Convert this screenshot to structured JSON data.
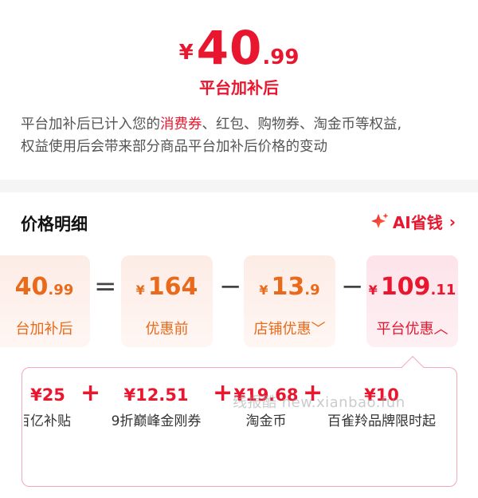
{
  "summary": {
    "currency": "¥",
    "price_int": "40",
    "price_dec": ".99",
    "label": "平台加补后",
    "note_before": "平台加补后已计入您的",
    "note_highlight": "消费券",
    "note_after": "、红包、购物券、淘金币等权益,",
    "note_line2": "权益使用后会带来部分商品平台加补后价格的变动"
  },
  "detail": {
    "title": "价格明细",
    "ai_label": "AI省钱",
    "chevron": "›"
  },
  "cards": [
    {
      "currency": "¥",
      "int": "40",
      "dec": ".99",
      "label": "台加补后"
    },
    {
      "currency": "¥",
      "int": "164",
      "dec": "",
      "label": "优惠前"
    },
    {
      "currency": "¥",
      "int": "13",
      "dec": ".9",
      "label": "店铺优惠﹀"
    },
    {
      "currency": "¥",
      "int": "109",
      "dec": ".11",
      "label": "平台优惠︿"
    }
  ],
  "operators": [
    "=",
    "−",
    "−"
  ],
  "breakdown": [
    {
      "value": "¥25",
      "label": "百亿补贴"
    },
    {
      "value": "¥12.51",
      "label": "9折巅峰金刚券"
    },
    {
      "value": "¥19.68",
      "label": "淘金币"
    },
    {
      "value": "¥10",
      "label": "百雀羚品牌限时起"
    }
  ],
  "plus": [
    "+",
    "+",
    "+"
  ],
  "watermark": "线报酷 new.xianbao.fun",
  "colors": {
    "accent": "#e8172f",
    "orange": "#e86a1a",
    "bg_gap": "#f5f5f5"
  }
}
